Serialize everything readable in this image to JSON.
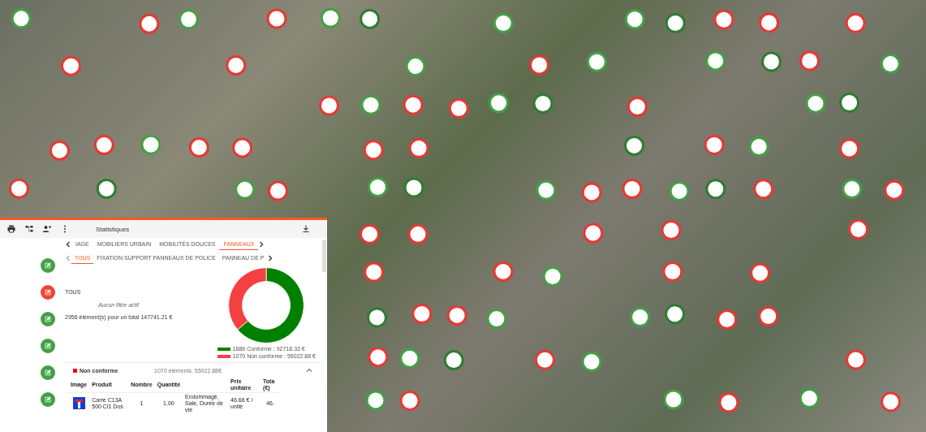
{
  "toolbar": {
    "title": "Statistiques"
  },
  "edit_buttons": [
    {
      "color": "#43a047"
    },
    {
      "color": "#f44336"
    },
    {
      "color": "#43a047"
    },
    {
      "color": "#43a047"
    },
    {
      "color": "#43a047"
    },
    {
      "color": "#43a047"
    }
  ],
  "tabs": [
    {
      "label": "IAGE",
      "selected": false
    },
    {
      "label": "MOBILIERS URBAIN",
      "selected": false
    },
    {
      "label": "MOBILITÉS DOUCES",
      "selected": false
    },
    {
      "label": "PANNEAUX",
      "selected": true
    }
  ],
  "subtabs": [
    {
      "label": "TOUS",
      "selected": true
    },
    {
      "label": "FIXATION SUPPORT PANNEAUX DE POLICE",
      "selected": false
    },
    {
      "label": "PANNEAU DE P",
      "selected": false
    }
  ],
  "summary": {
    "heading": "TOUS",
    "filter_note": "Aucun filtre actif",
    "total": "2956 élément(s) pour un total 147741.21 €"
  },
  "chart": {
    "chart_data": {
      "type": "donut",
      "values": [
        63.8,
        36.2
      ]
    },
    "legend": [
      {
        "label": "1886 Conforme : 92718.33 €",
        "color": "#008000"
      },
      {
        "label": "1070 Non conforme : 55022.88 €",
        "color": "#f44040"
      }
    ]
  },
  "group": {
    "label": "Non conforme",
    "color": "#ff0000",
    "count": "1070 éléments, 55022.88€",
    "expanded": true
  },
  "table": {
    "columns": [
      "Image",
      "Produit",
      "Nombre",
      "Quantité",
      "",
      "Prix unitaire",
      "Tota (€)"
    ],
    "rows": [
      {
        "cells": [
          "",
          "Carre C13A 500 Cl1 Dos",
          "1",
          "1.00",
          "Endommagé, Sale, Durée de vie",
          "46.66 € / unité",
          "46."
        ]
      }
    ]
  }
}
